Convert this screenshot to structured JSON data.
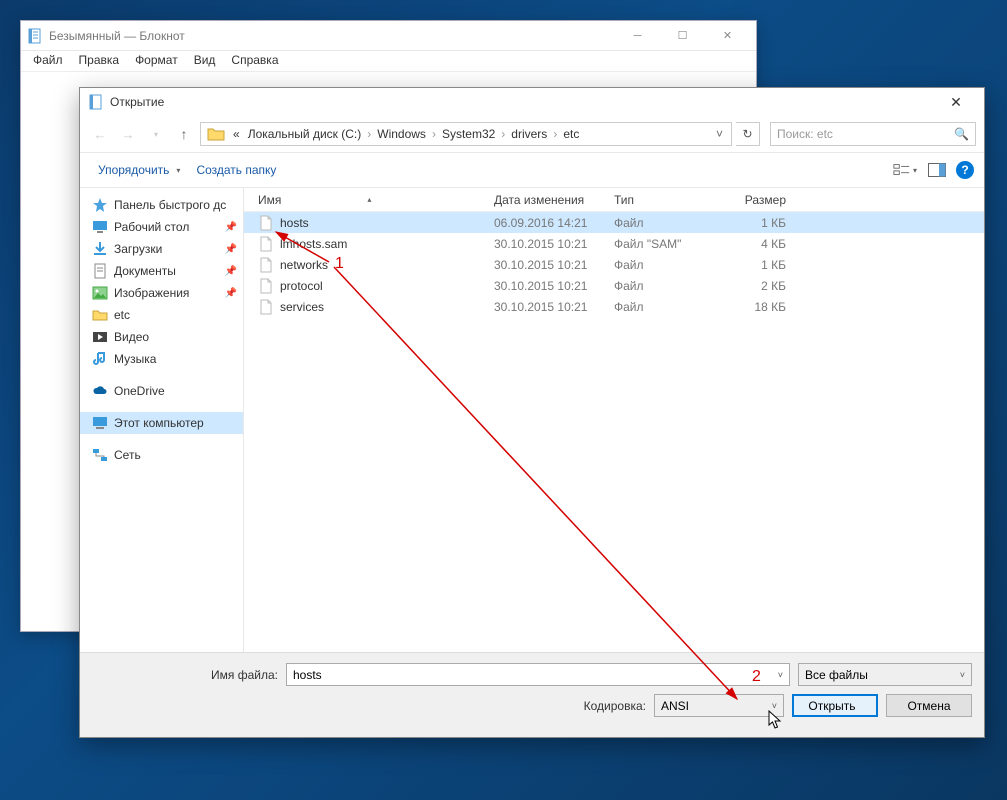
{
  "notepad": {
    "title": "Безымянный — Блокнот",
    "menu": [
      "Файл",
      "Правка",
      "Формат",
      "Вид",
      "Справка"
    ]
  },
  "dialog": {
    "title": "Открытие",
    "breadcrumbs_prefix": "«",
    "breadcrumbs": [
      "Локальный диск (C:)",
      "Windows",
      "System32",
      "drivers",
      "etc"
    ],
    "search_placeholder": "Поиск: etc",
    "organize": "Упорядочить",
    "new_folder": "Создать папку"
  },
  "sidebar": {
    "quick_access": "Панель быстрого дс",
    "items_pinned": [
      {
        "label": "Рабочий стол",
        "icon": "desktop"
      },
      {
        "label": "Загрузки",
        "icon": "downloads"
      },
      {
        "label": "Документы",
        "icon": "documents"
      },
      {
        "label": "Изображения",
        "icon": "pictures"
      }
    ],
    "etc": "etc",
    "video": "Видео",
    "music": "Музыка",
    "onedrive": "OneDrive",
    "this_pc": "Этот компьютер",
    "network": "Сеть"
  },
  "columns": {
    "name": "Имя",
    "date": "Дата изменения",
    "type": "Тип",
    "size": "Размер"
  },
  "files": [
    {
      "name": "hosts",
      "date": "06.09.2016 14:21",
      "type": "Файл",
      "size": "1 КБ",
      "selected": true
    },
    {
      "name": "lmhosts.sam",
      "date": "30.10.2015 10:21",
      "type": "Файл \"SAM\"",
      "size": "4 КБ"
    },
    {
      "name": "networks",
      "date": "30.10.2015 10:21",
      "type": "Файл",
      "size": "1 КБ"
    },
    {
      "name": "protocol",
      "date": "30.10.2015 10:21",
      "type": "Файл",
      "size": "2 КБ"
    },
    {
      "name": "services",
      "date": "30.10.2015 10:21",
      "type": "Файл",
      "size": "18 КБ"
    }
  ],
  "footer": {
    "filename_label": "Имя файла:",
    "filename_value": "hosts",
    "filter": "Все файлы",
    "encoding_label": "Кодировка:",
    "encoding_value": "ANSI",
    "open": "Открыть",
    "cancel": "Отмена"
  },
  "annotations": {
    "one": "1",
    "two": "2"
  }
}
